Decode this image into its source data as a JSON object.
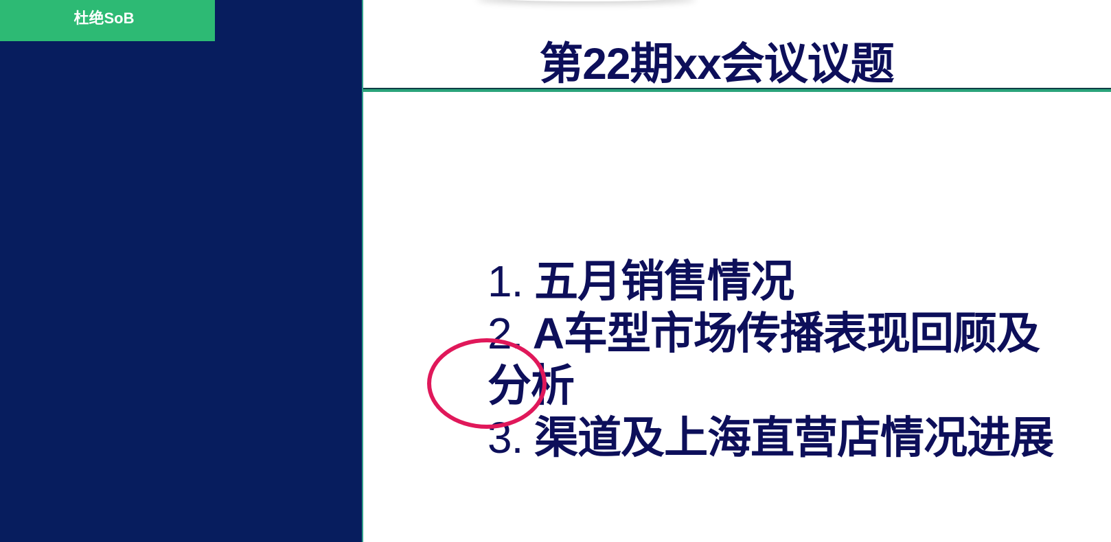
{
  "sidebar": {
    "author_label": "杜绝SoB",
    "panel_color": "#071d5e",
    "tag_color": "#2dba74"
  },
  "slide": {
    "title": "第22期xx会议议题",
    "title_color": "#0d0f5a",
    "rule_color": "#2aa37a",
    "agenda": [
      {
        "number": "1.",
        "text": "五月销售情况"
      },
      {
        "number": "2.",
        "text": "A车型市场传播表现回顾及分析"
      },
      {
        "number": "3.",
        "text": "渠道及上海直营店情况进展"
      }
    ],
    "annotation": {
      "shape": "ellipse",
      "color": "#e0185a"
    }
  }
}
